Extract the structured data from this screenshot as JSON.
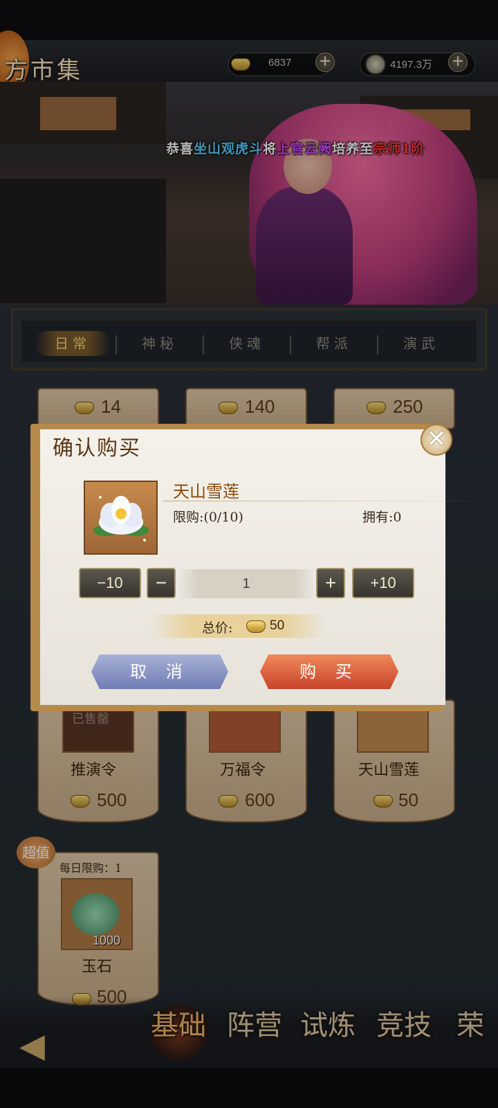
{
  "header": {
    "title": "方市集",
    "ingot_amount": "6837",
    "coin_amount": "4197.3万"
  },
  "broadcast": {
    "part1": "恭喜",
    "player": "坐山观虎斗",
    "part2": "将",
    "hero": "上官云阙",
    "part3": "培养至",
    "rank": "宗师1阶",
    "colors": {
      "normal": "#ffffff",
      "player": "#5ad0ff",
      "hero": "#d14cff",
      "rank": "#ff3b3b"
    }
  },
  "tabs": [
    {
      "label": "日常",
      "active": true
    },
    {
      "label": "神秘",
      "active": false
    },
    {
      "label": "侠魂",
      "active": false
    },
    {
      "label": "帮派",
      "active": false
    },
    {
      "label": "演武",
      "active": false
    }
  ],
  "shop": {
    "top_row_prices": [
      "14",
      "140",
      "250"
    ],
    "middle_row": [
      {
        "name": "推演令",
        "price": "500",
        "stamp": "已售罄"
      },
      {
        "name": "万福令",
        "price": "600"
      },
      {
        "name": "天山雪莲",
        "price": "50"
      }
    ],
    "special": {
      "badge": "超值",
      "limit": "每日限购：1",
      "name": "玉石",
      "count": "1000",
      "price": "500"
    }
  },
  "dialog": {
    "title": "确认购买",
    "item_name": "天山雪莲",
    "limit": "限购:(0/10)",
    "owned": "拥有:0",
    "minus10": "−10",
    "minus": "−",
    "quantity": "1",
    "plus": "+",
    "plus10": "+10",
    "total_label": "总价:",
    "total_value": "50",
    "cancel": "取 消",
    "confirm": "购 买",
    "close": "✕"
  },
  "bottom_nav": [
    {
      "label": "基础",
      "active": true
    },
    {
      "label": "阵营",
      "active": false
    },
    {
      "label": "试炼",
      "active": false
    },
    {
      "label": "竞技",
      "active": false
    },
    {
      "label": "荣",
      "active": false
    }
  ]
}
